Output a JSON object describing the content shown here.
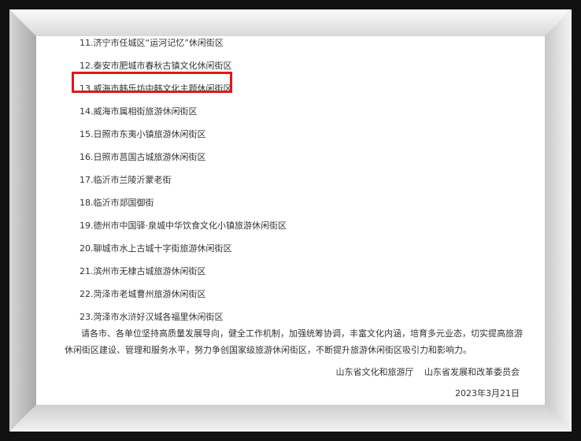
{
  "document": {
    "items": [
      "11.济宁市任城区“运河记忆”休闲街区",
      "12.泰安市肥城市春秋古镇文化休闲街区",
      "13.威海市韩乐坊中韩文化主题休闲街区",
      "14.威海市属相街旅游休闲街区",
      "15.日照市东夷小镇旅游休闲街区",
      "16.日照市莒国古城旅游休闲街区",
      "17.临沂市兰陵沂蒙老街",
      "18.临沂市郯国御街",
      "19.德州市中国驿·泉城中华饮食文化小镇旅游休闲街区",
      "20.聊城市水上古城十字街旅游休闲街区",
      "21.滨州市无棣古城旅游休闲街区",
      "22.菏泽市老城曹州旅游休闲街区",
      "23.菏泽市水浒好汉城各福里休闲街区"
    ],
    "highlighted_item_index": 2,
    "highlight_color": "#e0161e",
    "paragraph": "请各市、各单位坚持高质量发展导向，健全工作机制，加强统筹协调，丰富文化内涵，培育多元业态，切实提高旅游休闲街区建设、管理和服务水平，努力争创国家级旅游休闲街区，不断提升旅游休闲街区吸引力和影响力。",
    "signatures": [
      "山东省文化和旅游厅",
      "山东省发展和改革委员会"
    ],
    "date": "2023年3月21日"
  }
}
